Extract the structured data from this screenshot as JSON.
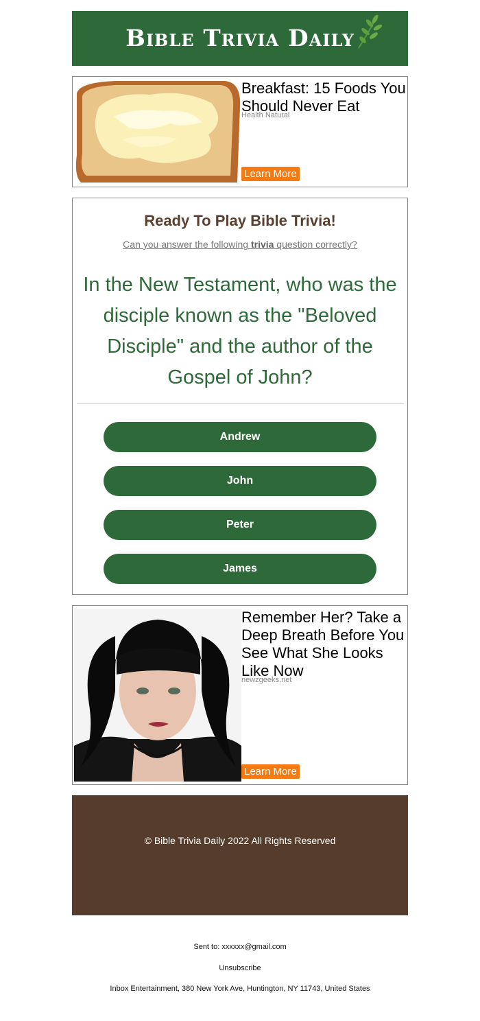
{
  "header": {
    "logo_text": "Bible Trivia Daily",
    "bg_color": "#2e6939"
  },
  "ad1": {
    "title": "Breakfast: 15 Foods You Should Never Eat",
    "source": "Health Natural",
    "button_label": "Learn More",
    "image": "toast-with-butter-photo"
  },
  "trivia": {
    "heading": "Ready To Play Bible Trivia!",
    "sub_before": "Can you answer the following ",
    "sub_bold": "trivia",
    "sub_after": " question correctly?",
    "question": "In the New Testament, who was the disciple known as the \"Beloved Disciple\" and the author of the Gospel of John?",
    "answers": [
      "Andrew",
      "John",
      "Peter",
      "James"
    ]
  },
  "ad2": {
    "title": "Remember Her? Take a Deep Breath Before You See What She Looks Like Now",
    "source": "newzgeeks.net",
    "button_label": "Learn More",
    "image": "woman-portrait-photo"
  },
  "footer": {
    "copyright": "© Bible Trivia Daily 2022 All Rights Reserved",
    "bg_color": "#563c2c"
  },
  "meta": {
    "sent_to": "Sent to: xxxxxx@gmail.com",
    "unsubscribe": "Unsubscribe",
    "address": "Inbox Entertainment, 380 New York Ave, Huntington, NY 11743, United States"
  },
  "colors": {
    "accent_green": "#2e6939",
    "ad_button_orange": "#f47b13",
    "heading_brown": "#5a3f2e"
  }
}
